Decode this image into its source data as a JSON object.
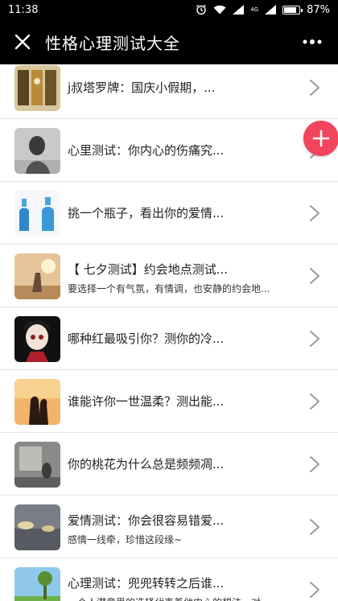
{
  "status_bar": {
    "time": "11:38",
    "network_label": "4G",
    "battery_text": "87%",
    "battery_level": 0.87
  },
  "title_bar": {
    "title": "性格心理测试大全"
  },
  "list": [
    {
      "title": "j叔塔罗牌：国庆小假期，...",
      "subtitle": "",
      "thumb": "tarot-cards"
    },
    {
      "title": "心里测试：你内心的伤痛究...",
      "subtitle": "",
      "thumb": "grayscale-girl"
    },
    {
      "title": "挑一个瓶子，看出你的爱情...",
      "subtitle": "",
      "thumb": "blue-bottles"
    },
    {
      "title": "【 七夕测试】约会地点测试...",
      "subtitle": "要选择一个有气氛，有情调，也安静的约会地...",
      "thumb": "couple-sunset"
    },
    {
      "title": "哪种红最吸引你？测你的冷...",
      "subtitle": "",
      "thumb": "doll-face"
    },
    {
      "title": "谁能许你一世温柔？测出能...",
      "subtitle": "",
      "thumb": "silhouette-kiss"
    },
    {
      "title": "你的桃花为什么总是频频凋...",
      "subtitle": "",
      "thumb": "woman-window"
    },
    {
      "title": "爱情测试：你会很容易错爱...",
      "subtitle": "感情一线牵，珍惜这段缘~",
      "thumb": "rainy-street"
    },
    {
      "title": "心理测试：兜兜转转之后谁...",
      "subtitle": "一个人潜意思的选择代表着他内心的想法，对...",
      "thumb": "field-sky"
    }
  ],
  "colors": {
    "bar_bg": "#000000",
    "fab": "#f2445c",
    "chevron": "#9a9a9a"
  },
  "icons": {
    "close": "close-icon",
    "more": "more-dots-icon",
    "fab": "plus-icon",
    "chevron": "chevron-right-icon"
  }
}
